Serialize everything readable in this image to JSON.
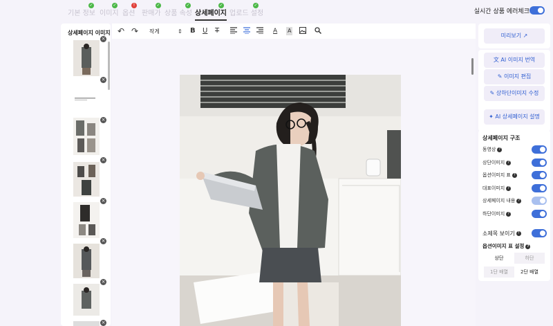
{
  "tabs": [
    {
      "label": "기본 정보",
      "status": "ok"
    },
    {
      "label": "이미지",
      "status": "ok"
    },
    {
      "label": "옵션",
      "status": "error"
    },
    {
      "label": "판매가",
      "status": "ok"
    },
    {
      "label": "상품 속성",
      "status": "ok"
    },
    {
      "label": "상세페이지",
      "status": "ok",
      "active": true
    },
    {
      "label": "업로드 설정",
      "status": "ok"
    }
  ],
  "realtime_check": {
    "label": "실시간 상품 에러체크",
    "enabled": true
  },
  "left_panel": {
    "title": "상세페이지 이미지",
    "close_glyph": "×"
  },
  "toolbar": {
    "font_size": "작게",
    "undo_icon": "↶",
    "redo_icon": "↷",
    "size_arrows": "⇕",
    "bold": "B",
    "underline": "U",
    "strike": "T",
    "color_text": "A",
    "bg_text": "A"
  },
  "right_panel": {
    "preview": "미리보기",
    "ai_translate": "AI 이미지 번역",
    "image_edit": "이미지 편집",
    "top_bottom_edit": "상하단이미지 수정",
    "ai_description": "AI 상세페이지 설명",
    "structure_title": "상세페이지 구조",
    "structure_items": [
      {
        "label": "동영상",
        "on": true
      },
      {
        "label": "상단이미지",
        "on": true
      },
      {
        "label": "옵션이미지 표",
        "on": true
      },
      {
        "label": "대표이미지",
        "on": true
      },
      {
        "label": "상세페이지 내용",
        "on": true,
        "light": true
      },
      {
        "label": "하단이미지",
        "on": true
      }
    ],
    "subtitle_show": {
      "label": "소제목 보이기",
      "on": true
    },
    "option_table_title": "옵션이미지 표 설정",
    "position": {
      "top": "상단",
      "bottom": "하단",
      "selected": "top"
    },
    "layout": {
      "one": "1단 배열",
      "two": "2단 배열",
      "selected": "two"
    }
  },
  "colors": {
    "accent": "#3e6fd9",
    "ok": "#4cb848",
    "error": "#e0403a"
  }
}
